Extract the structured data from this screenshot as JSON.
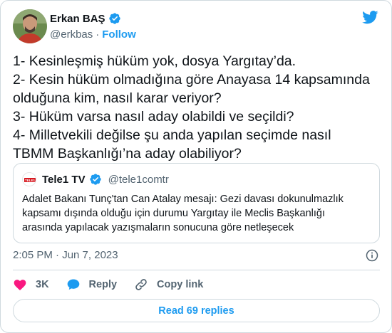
{
  "author": {
    "name": "Erkan BAŞ",
    "handle": "@erkbas",
    "follow_label": "Follow",
    "separator": "·"
  },
  "tweet": {
    "lines": [
      "1- Kesinleşmiş hüküm yok, dosya Yargıtay’da.",
      "2- Kesin hüküm olmadığına göre Anayasa 14 kapsamında",
      "olduğuna kim, nasıl karar veriyor?",
      "3- Hüküm varsa nasıl aday olabildi ve seçildi?",
      "4- Milletvekili değilse şu anda yapılan seçimde nasıl",
      "TBMM Başkanlığı’na aday olabiliyor?"
    ]
  },
  "quote": {
    "name": "Tele1 TV",
    "handle": "@tele1comtr",
    "avatar_text": "TELE1",
    "lines": [
      "Adalet Bakanı Tunç'tan Can Atalay mesajı: Gezi davası dokunulmazlık",
      "kapsamı dışında olduğu için durumu Yargıtay ile Meclis Başkanlığı",
      "arasında yapılacak yazışmaların sonucuna göre netleşecek"
    ]
  },
  "meta": {
    "timestamp": "2:05 PM · Jun 7, 2023"
  },
  "actions": {
    "like_count": "3K",
    "reply_label": "Reply",
    "copy_label": "Copy link"
  },
  "read_replies_label": "Read 69 replies",
  "colors": {
    "accent": "#1d9bf0",
    "like": "#f91880",
    "text": "#0f1419",
    "muted": "#536471",
    "border": "#cfd9de"
  },
  "icons": {
    "twitter": "twitter-bird-icon",
    "verified": "verified-badge-icon",
    "info": "info-icon",
    "like": "heart-icon",
    "reply": "speech-bubble-icon",
    "copy": "link-icon"
  }
}
